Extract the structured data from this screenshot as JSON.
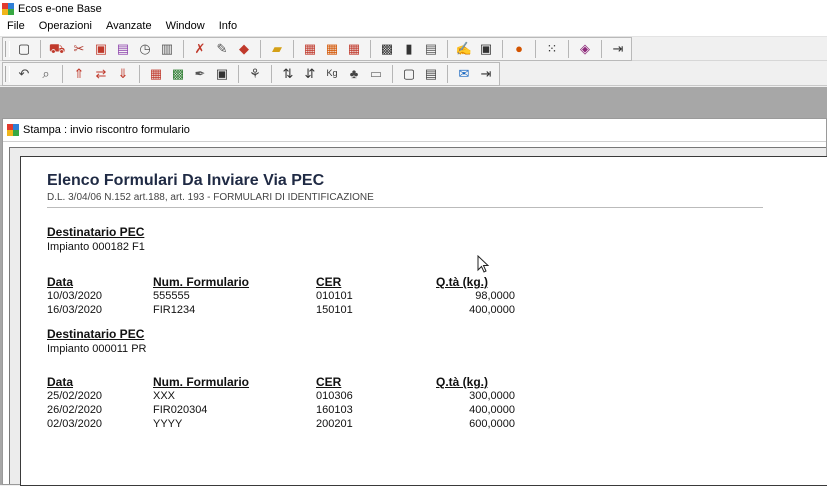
{
  "window": {
    "title": "Ecos e-one Base"
  },
  "menu": [
    "File",
    "Operazioni",
    "Avanzate",
    "Window",
    "Info"
  ],
  "toolbar1_icons": [
    "window-icon",
    "truck-icon",
    "wrench-icon",
    "printer-icon",
    "printer2-icon",
    "clock-icon",
    "trash-icon",
    "tools-icon",
    "edit-icon",
    "diamond-icon",
    "folder-icon",
    "docs-icon",
    "docs2-icon",
    "docs3-icon",
    "calendar-icon",
    "chart-icon",
    "printer3-icon",
    "paint-icon",
    "book-icon",
    "search-icon",
    "grid-icon",
    "heart-icon",
    "exit-icon"
  ],
  "toolbar2_icons": [
    "back-icon",
    "search2-icon",
    "up-icon",
    "swap-icon",
    "down-icon",
    "filter-icon",
    "excel-icon",
    "sign-icon",
    "calc-icon",
    "group-icon",
    "sort-az-icon",
    "sort-icon",
    "kg-ton-icon",
    "tree-icon",
    "folder2-icon",
    "preview-icon",
    "print-icon",
    "mail-icon",
    "exit2-icon"
  ],
  "doc": {
    "window_title": "Stampa : invio riscontro formulario",
    "report_title": "Elenco Formulari Da Inviare Via PEC",
    "report_subtitle": "D.L. 3/04/06 N.152 art.188, art. 193 - FORMULARI DI IDENTIFICAZIONE",
    "headers": [
      "Data",
      "Num. Formulario",
      "CER",
      "Q.tà (kg.)"
    ],
    "groups": [
      {
        "label": "Destinatario PEC",
        "plant": "Impianto 000182 F1",
        "rows": [
          [
            "10/03/2020",
            "555555",
            "010101",
            "98,0000"
          ],
          [
            "16/03/2020",
            "FIR1234",
            "150101",
            "400,0000"
          ]
        ]
      },
      {
        "label": "Destinatario PEC",
        "plant": "Impianto 000011 PR",
        "rows": [
          [
            "25/02/2020",
            "XXX",
            "010306",
            "300,0000"
          ],
          [
            "26/02/2020",
            "FIR020304",
            "160103",
            "400,0000"
          ],
          [
            "02/03/2020",
            "YYYY",
            "200201",
            "600,0000"
          ]
        ]
      }
    ]
  }
}
